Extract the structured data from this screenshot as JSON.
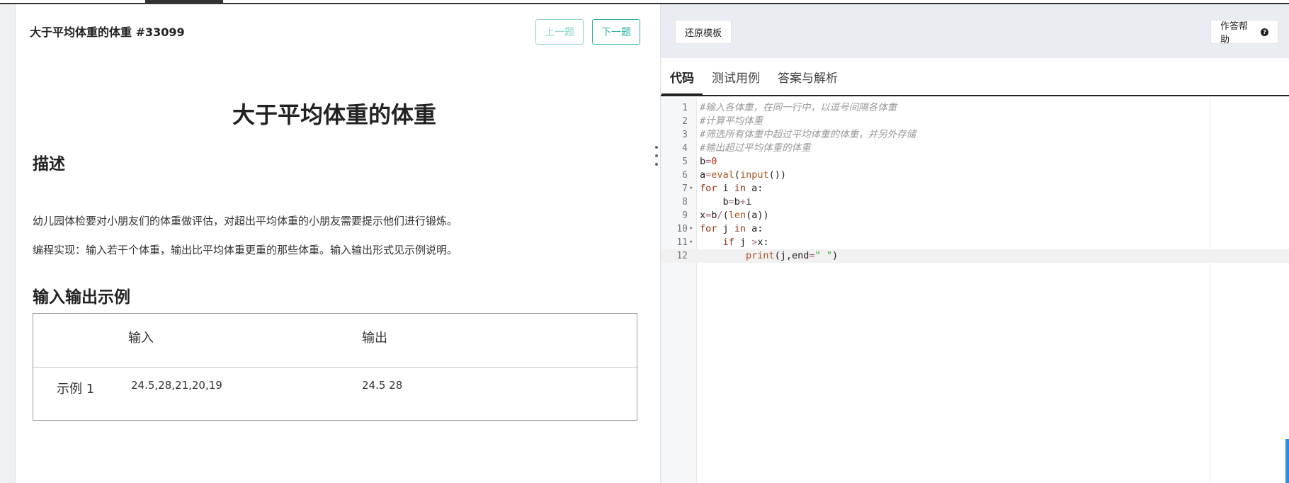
{
  "problem": {
    "title": "大于平均体重的体重 #33099",
    "heading": "大于平均体重的体重",
    "prev_button": "上一题",
    "next_button": "下一题",
    "description_heading": "描述",
    "description_p1": "幼儿园体检要对小朋友们的体重做评估，对超出平均体重的小朋友需要提示他们进行锻炼。",
    "description_p2": "编程实现：输入若干个体重，输出比平均体重更重的那些体重。输入输出形式见示例说明。",
    "io_heading": "输入输出示例",
    "io_table": {
      "headers": [
        "输入",
        "输出"
      ],
      "rows": [
        {
          "label": "示例 1",
          "input": "24.5,28,21,20,19",
          "output": "24.5 28"
        }
      ]
    }
  },
  "editor_panel": {
    "restore_button": "还原模板",
    "help_button": "作答帮助",
    "help_icon": "question-circle-icon",
    "tabs": [
      "代码",
      "测试用例",
      "答案与解析"
    ],
    "active_tab": "代码",
    "line_numbers": [
      "1",
      "2",
      "3",
      "4",
      "5",
      "6",
      "7",
      "8",
      "9",
      "10",
      "11",
      "12"
    ],
    "code_lines": [
      "#输入各体重，在同一行中，以逗号间隔各体重",
      "#计算平均体重",
      "#筛选所有体重中超过平均体重的体重，并另外存储",
      "#输出超过平均体重的体重",
      "b=0",
      "a=eval(input())",
      "for i in a:",
      "    b=b+i",
      "x=b/(len(a))",
      "for j in a:",
      "    if j >x:",
      "        print(j,end=\" \")"
    ]
  },
  "colors": {
    "accent_teal": "#2bb3a5",
    "toolbar_bg": "#e9ecf0",
    "comment": "#999999",
    "keyword": "#993311"
  }
}
